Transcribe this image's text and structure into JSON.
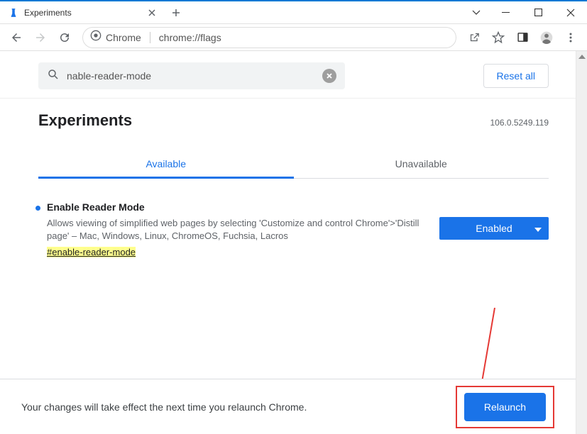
{
  "titlebar": {
    "tab_title": "Experiments"
  },
  "toolbar": {
    "chrome_label": "Chrome",
    "url": "chrome://flags"
  },
  "search": {
    "value": "nable-reader-mode",
    "reset_label": "Reset all"
  },
  "header": {
    "title": "Experiments",
    "version": "106.0.5249.119"
  },
  "tabs": {
    "available": "Available",
    "unavailable": "Unavailable"
  },
  "flag": {
    "title": "Enable Reader Mode",
    "desc": "Allows viewing of simplified web pages by selecting 'Customize and control Chrome'>'Distill page' – Mac, Windows, Linux, ChromeOS, Fuchsia, Lacros",
    "hash": "#enable-reader-mode",
    "selected": "Enabled"
  },
  "bottom": {
    "message": "Your changes will take effect the next time you relaunch Chrome.",
    "relaunch": "Relaunch"
  }
}
